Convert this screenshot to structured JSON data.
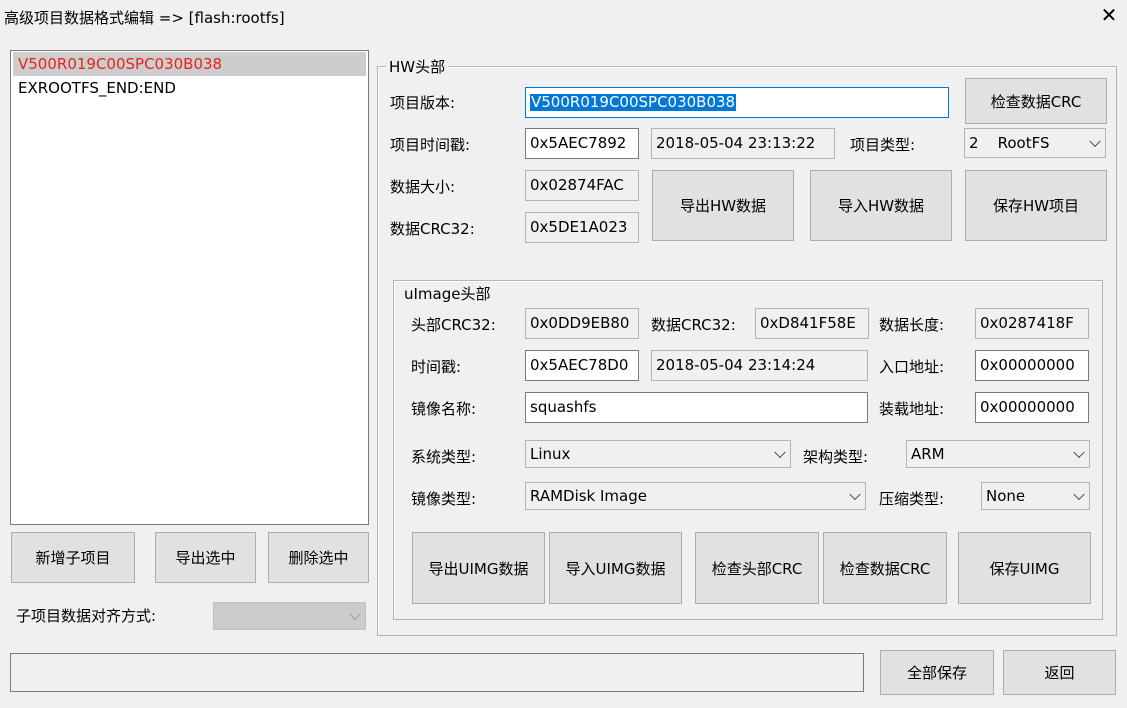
{
  "window": {
    "title": "高级项目数据格式编辑 => [flash:rootfs]",
    "close_glyph": "✕"
  },
  "list": {
    "items": [
      "V500R019C00SPC030B038",
      "EXROOTFS_END:END"
    ]
  },
  "left_buttons": {
    "add": "新增子项目",
    "export": "导出选中",
    "delete": "删除选中"
  },
  "align": {
    "label": "子项目数据对齐方式:",
    "value": ""
  },
  "hw": {
    "group_title": "HW头部",
    "version_label": "项目版本:",
    "version_value": "V500R019C00SPC030B038",
    "check_crc": "检查数据CRC",
    "timestamp_label": "项目时间戳:",
    "timestamp_value": "0x5AEC7892",
    "timestamp_date": "2018-05-04 23:13:22",
    "type_label": "项目类型:",
    "type_value": "2    RootFS",
    "size_label": "数据大小:",
    "size_value": "0x02874FAC",
    "crc_label": "数据CRC32:",
    "crc_value": "0x5DE1A023",
    "export": "导出HW数据",
    "import": "导入HW数据",
    "save": "保存HW项目"
  },
  "uimage": {
    "group_title": "uImage头部",
    "hcrc_label": "头部CRC32:",
    "hcrc_value": "0x0DD9EB80",
    "dcrc_label": "数据CRC32:",
    "dcrc_value": "0xD841F58E",
    "dlen_label": "数据长度:",
    "dlen_value": "0x0287418F",
    "ts_label": "时间戳:",
    "ts_value": "0x5AEC78D0",
    "ts_date": "2018-05-04 23:14:24",
    "entry_label": "入口地址:",
    "entry_value": "0x00000000",
    "name_label": "镜像名称:",
    "name_value": "squashfs",
    "load_label": "装载地址:",
    "load_value": "0x00000000",
    "os_label": "系统类型:",
    "os_value": "Linux",
    "arch_label": "架构类型:",
    "arch_value": "ARM",
    "imgtype_label": "镜像类型:",
    "imgtype_value": "RAMDisk Image",
    "comp_label": "压缩类型:",
    "comp_value": "None",
    "btn_export": "导出UIMG数据",
    "btn_import": "导入UIMG数据",
    "btn_check_header": "检查头部CRC",
    "btn_check_data": "检查数据CRC",
    "btn_save": "保存UIMG"
  },
  "bottom": {
    "status": "",
    "save_all": "全部保存",
    "back": "返回"
  }
}
